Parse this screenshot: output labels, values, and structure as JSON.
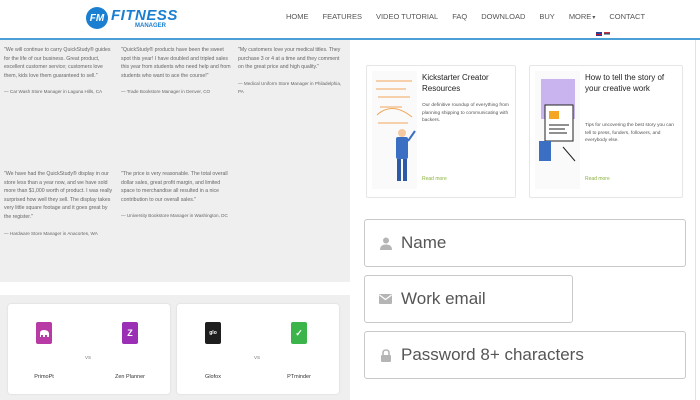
{
  "header": {
    "logo_badge": "FM",
    "logo_main": "FITNESS",
    "logo_sub": "MANAGER",
    "nav": [
      "HOME",
      "FEATURES",
      "VIDEO TUTORIAL",
      "FAQ",
      "DOWNLOAD",
      "BUY",
      "MORE",
      "CONTACT"
    ],
    "accent_color": "#1a7fd1",
    "border_color": "#4a9fd6"
  },
  "testimonials": [
    {
      "quote": "\"We will continue to carry QuickStudy® guides for the life of our business. Great product, excellent customer service; customers love them, kids love them guaranteed to sell.\"",
      "author": "— Car Wash Store Manager in Laguna Hills, CA"
    },
    {
      "quote": "\"QuickStudy® products have been the sweet spot this year! I have doubled and tripled sales this year from students who need help and from students who want to ace the course!\"",
      "author": "— Trade Bookstore Manager in Denver, CO"
    },
    {
      "quote": "\"My customers love your medical titles. They purchase 3 or 4 at a time and they comment on the great price and high quality.\"",
      "author": "— Medical Uniform Store Manager in Philadelphia, PA"
    },
    {
      "quote": "\"We have had the QuickStudy® display in our store less than a year now, and we have sold more than $1,000 worth of product. I was really surprised how well they sell. The display takes very little square footage and it goes great by the register.\"",
      "author": "— Hardware Store Manager in Anacortes, WA"
    },
    {
      "quote": "\"The price is very reasonable. The total overall dollar sales, great profit margin, and limited space to merchandise all resulted in a nice contribution to our overall sales.\"",
      "author": "— University Bookstore Manager in Washington, DC"
    }
  ],
  "comparisons": [
    {
      "left": {
        "name": "PrimoPt",
        "color": "#b83aa4",
        "glyph": "🐘"
      },
      "vs": "VS",
      "right": {
        "name": "Zen Planner",
        "color": "#9a2fb5",
        "glyph": "Z"
      }
    },
    {
      "left": {
        "name": "Glofox",
        "color": "#1e1e1e",
        "glyph": "glo"
      },
      "vs": "VS",
      "right": {
        "name": "PTminder",
        "color": "#3bb54a",
        "glyph": "✓"
      }
    }
  ],
  "blogs": [
    {
      "title": "Kickstarter Creator Resources",
      "description": "Our definitive roundup of everything from planning shipping to communicating with backers.",
      "more": "Read more"
    },
    {
      "title": "How to tell the story of your creative work",
      "description": "Tips for uncovering the best story you can tell to press, funders, followers, and everybody else.",
      "more": "Read more"
    }
  ],
  "form": {
    "name_placeholder": "Name",
    "email_placeholder": "Work email",
    "password_placeholder": "Password 8+ characters"
  }
}
